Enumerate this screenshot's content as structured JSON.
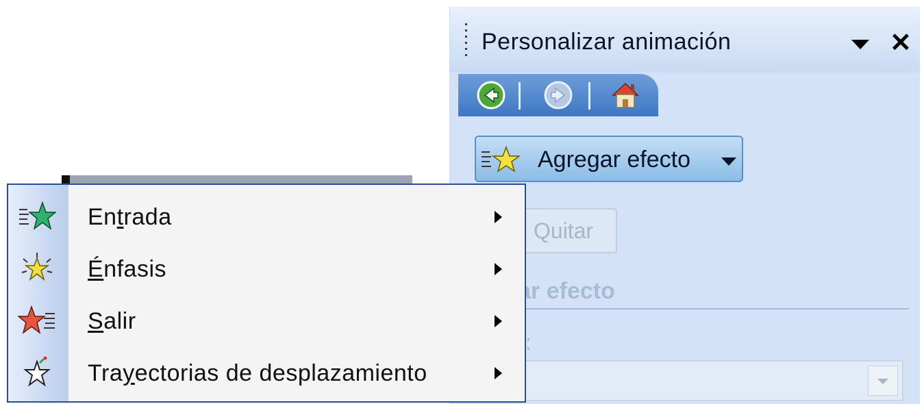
{
  "task_pane": {
    "title": "Personalizar animación",
    "nav": {
      "back_icon": "back-arrow-icon",
      "forward_icon": "forward-arrow-icon",
      "home_icon": "home-icon"
    },
    "add_effect_label": "Agregar efecto",
    "remove_label": "Quitar",
    "modify_section_fragment": "ificar efecto",
    "start_label_fragment": ":"
  },
  "menu": {
    "items": [
      {
        "pre": "En",
        "accel": "t",
        "post": "rada",
        "icon": "entrance-star-icon"
      },
      {
        "pre": "",
        "accel": "É",
        "post": "nfasis",
        "icon": "emphasis-star-icon"
      },
      {
        "pre": "",
        "accel": "S",
        "post": "alir",
        "icon": "exit-star-icon"
      },
      {
        "pre": "Tra",
        "accel": "y",
        "post": "ectorias de desplazamiento",
        "icon": "motion-path-star-icon"
      }
    ]
  },
  "colors": {
    "pane_bg": "#d3e2f6",
    "nav_bar": "#4f86cc",
    "menu_border": "#2a4d93",
    "entrance_star": "#2db36b",
    "emphasis_star": "#f1e13a",
    "exit_star": "#e2553f"
  }
}
